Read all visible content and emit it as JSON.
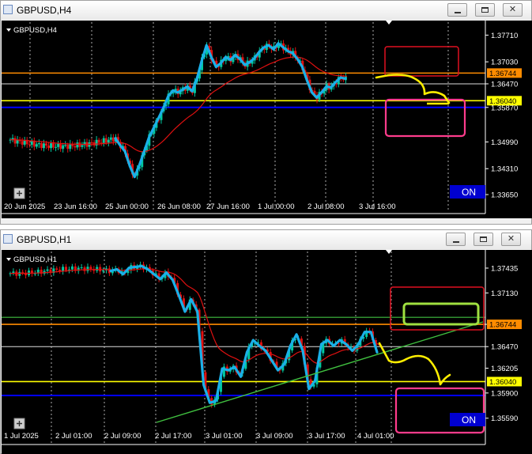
{
  "windows": [
    {
      "title": "GBPUSD,H4",
      "symbol_label": "GBPUSD,H4",
      "on_label": "ON",
      "price_ticks": [
        "1.37710",
        "1.37030",
        "1.36470",
        "1.35870",
        "1.34990",
        "1.34310",
        "1.33650"
      ],
      "tick_values": [
        1.3771,
        1.3703,
        1.3647,
        1.3587,
        1.3499,
        1.3431,
        1.3365
      ],
      "level_labels": [
        {
          "text": "1.36744",
          "value": 1.36744,
          "bg": "#ff8c00"
        },
        {
          "text": "1.36040",
          "value": 1.3604,
          "bg": "#ffff00"
        }
      ],
      "time_labels": [
        "20 Jun 2025",
        "23 Jun 16:00",
        "25 Jun 00:00",
        "26 Jun 08:00",
        "27 Jun 16:00",
        "1 Jul 00:00",
        "2 Jul 08:00",
        "3 Jul 16:00"
      ]
    },
    {
      "title": "GBPUSD,H1",
      "symbol_label": "GBPUSD,H1",
      "on_label": "ON",
      "price_ticks": [
        "1.37435",
        "1.37130",
        "1.36744",
        "1.36470",
        "1.36205",
        "1.35900",
        "1.35590"
      ],
      "tick_values": [
        1.37435,
        1.3713,
        1.36744,
        1.3647,
        1.36205,
        1.359,
        1.3559
      ],
      "level_labels": [
        {
          "text": "1.36744",
          "value": 1.36744,
          "bg": "#ff8c00"
        },
        {
          "text": "1.36040",
          "value": 1.3604,
          "bg": "#ffff00"
        }
      ],
      "time_labels": [
        "1 Jul 2025",
        "2 Jul 01:00",
        "2 Jul 09:00",
        "2 Jul 17:00",
        "3 Jul 01:00",
        "3 Jul 09:00",
        "3 Jul 17:00",
        "4 Jul 01:00"
      ]
    }
  ],
  "colors": {
    "background": "#000000",
    "grid": "#ffffff",
    "bull_candle": "#00c8a0",
    "bear_candle": "#e01010",
    "moving_average": "#e01010",
    "drawn_trace": "#1ab0e8",
    "projection": "#ffee00",
    "resistance_level": "#ff8c00",
    "support_level": "#ffff00",
    "low_level": "#0000ff",
    "upper_zone": "#e01020",
    "lower_zone": "#ff3c8c",
    "target_zone": "#a0e040",
    "trendline": "#40c040",
    "on_badge": "#0000d0"
  },
  "chart_data": [
    {
      "type": "candlestick",
      "title": "GBPUSD,H4",
      "x_tick_labels": [
        "20 Jun 2025",
        "23 Jun 16:00",
        "25 Jun 00:00",
        "26 Jun 08:00",
        "27 Jun 16:00",
        "1 Jul 00:00",
        "2 Jul 08:00",
        "3 Jul 16:00"
      ],
      "ylim": [
        1.3365,
        1.38
      ],
      "y_ticks": [
        1.3771,
        1.3703,
        1.3647,
        1.3587,
        1.3499,
        1.3431,
        1.3365
      ],
      "grid": "vertical dotted",
      "close_trace": [
        1.3508,
        1.349,
        1.3475,
        1.3438,
        1.341,
        1.344,
        1.3475,
        1.351,
        1.3535,
        1.356,
        1.3585,
        1.3615,
        1.363,
        1.3625,
        1.3632,
        1.364,
        1.3628,
        1.366,
        1.3705,
        1.3745,
        1.3715,
        1.369,
        1.37,
        1.3715,
        1.3708,
        1.372,
        1.371,
        1.3695,
        1.3702,
        1.3712,
        1.3728,
        1.374,
        1.3745,
        1.3735,
        1.375,
        1.374,
        1.373,
        1.3725,
        1.371,
        1.369,
        1.3655,
        1.3625,
        1.3612,
        1.3625,
        1.364,
        1.3638,
        1.3652,
        1.3663,
        1.366
      ],
      "levels": [
        1.36744,
        1.3647,
        1.3604,
        1.3587
      ]
    },
    {
      "type": "candlestick",
      "title": "GBPUSD,H1",
      "x_tick_labels": [
        "1 Jul 2025",
        "2 Jul 01:00",
        "2 Jul 09:00",
        "2 Jul 17:00",
        "3 Jul 01:00",
        "3 Jul 09:00",
        "3 Jul 17:00",
        "4 Jul 01:00"
      ],
      "ylim": [
        1.355,
        1.376
      ],
      "y_ticks": [
        1.37435,
        1.3713,
        1.36744,
        1.3647,
        1.36205,
        1.359,
        1.3559
      ],
      "grid": "vertical dotted",
      "close_trace": [
        1.374,
        1.3742,
        1.3736,
        1.3744,
        1.3745,
        1.3746,
        1.3742,
        1.3736,
        1.373,
        1.3738,
        1.3729,
        1.371,
        1.369,
        1.3705,
        1.369,
        1.36,
        1.3578,
        1.358,
        1.362,
        1.3618,
        1.3622,
        1.361,
        1.364,
        1.3655,
        1.3648,
        1.3642,
        1.363,
        1.3618,
        1.3625,
        1.3648,
        1.3662,
        1.3642,
        1.3595,
        1.3605,
        1.365,
        1.3655,
        1.3648,
        1.3655,
        1.365,
        1.3642,
        1.365,
        1.3665,
        1.3665,
        1.364
      ],
      "levels": [
        1.36744,
        1.3647,
        1.3604,
        1.3587
      ]
    }
  ]
}
